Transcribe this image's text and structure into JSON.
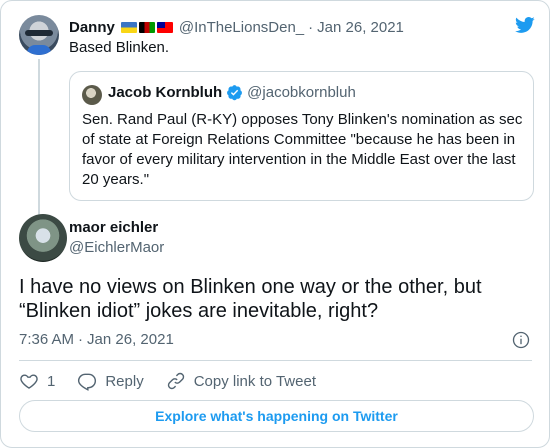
{
  "parent_tweet": {
    "name": "Danny",
    "flags": [
      "ukraine-flag",
      "afghanistan-flag",
      "taiwan-flag"
    ],
    "handle": "@InTheLionsDen_",
    "separator": "·",
    "date": "Jan 26, 2021",
    "text": "Based Blinken."
  },
  "quoted_tweet": {
    "name": "Jacob Kornbluh",
    "verified": true,
    "handle": "@jacobkornbluh",
    "text": "Sen. Rand Paul (R-KY) opposes Tony Blinken's nomination as sec of state at Foreign Relations Committee \"because he has been in favor of every military intervention in the Middle East over the last 20 years.\""
  },
  "main_tweet": {
    "name": "maor eichler",
    "handle": "@EichlerMaor",
    "text": "I have no views on Blinken one way or the other, but “Blinken idiot” jokes are inevitable, right?",
    "time": "7:36 AM",
    "separator": "·",
    "date": "Jan 26, 2021"
  },
  "actions": {
    "like_count": "1",
    "reply_label": "Reply",
    "copy_link_label": "Copy link to Tweet"
  },
  "explore_label": "Explore what's happening on Twitter",
  "colors": {
    "accent": "#1d9bf0",
    "text": "#0f1419",
    "muted": "#536471",
    "border": "#cfd9de"
  },
  "icons": [
    "twitter-bird-icon",
    "verified-badge-icon",
    "info-icon",
    "heart-icon",
    "reply-icon",
    "link-icon"
  ]
}
